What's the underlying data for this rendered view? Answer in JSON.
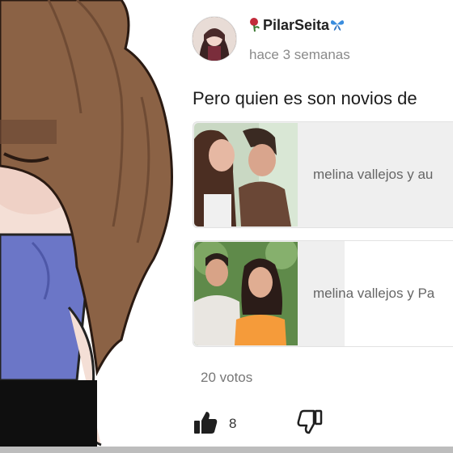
{
  "post": {
    "author": "PilarSeita",
    "time_ago": "hace 3 semanas",
    "text": "Pero quien es son novios de",
    "poll": {
      "options": [
        {
          "label": "melina vallejos y au"
        },
        {
          "label": "melina vallejos y Pa"
        }
      ],
      "votes_text": "20 votos"
    },
    "likes": "8"
  },
  "icons": {
    "badge_left": "rose-icon",
    "badge_right": "butterfly-icon",
    "like": "thumbs-up-icon",
    "dislike": "thumbs-down-icon"
  },
  "colors": {
    "accent": "#3a8dde",
    "text": "#1c1c1c",
    "muted": "#8a8a8a",
    "option_bg": "#efefef"
  }
}
